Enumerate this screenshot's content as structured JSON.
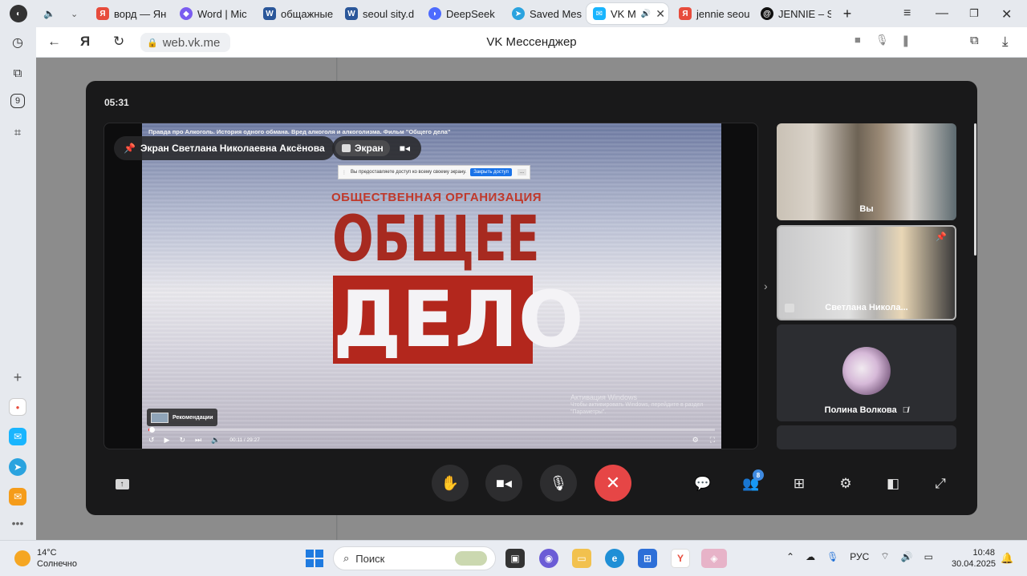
{
  "browser": {
    "tabs": [
      {
        "label": "ворд — Ян",
        "icon": "yandex-icon",
        "color": "#e74c3c"
      },
      {
        "label": "Word | Mic",
        "icon": "copilot-icon",
        "color": "#7a5cf0"
      },
      {
        "label": "общажные",
        "icon": "word-icon",
        "color": "#2b579a"
      },
      {
        "label": "seoul sity.d",
        "icon": "word-icon",
        "color": "#2b579a"
      },
      {
        "label": "DeepSeek",
        "icon": "deepseek-icon",
        "color": "#4d6bfe"
      },
      {
        "label": "Saved Mes",
        "icon": "telegram-icon",
        "color": "#2aa3df"
      },
      {
        "label": "VK M",
        "icon": "vk-messenger-icon",
        "color": "#19b5fe",
        "active": true
      },
      {
        "label": "jennie seou",
        "icon": "yandex-icon",
        "color": "#e74c3c"
      },
      {
        "label": "JENNIE – S",
        "icon": "threads-icon",
        "color": "#111111"
      }
    ],
    "url": "web.vk.me",
    "page_title": "VK Мессенджер"
  },
  "call": {
    "timer": "05:31",
    "screen_share_label": "Экран Светлана Николаевна Аксёнова",
    "screen_tab_label": "Экран",
    "participants": [
      {
        "name": "Вы"
      },
      {
        "name": "Светлана Никола..."
      },
      {
        "name": "Полина Волкова"
      }
    ],
    "participants_count": "8"
  },
  "video": {
    "title": "Правда про Алкоголь. История одного обмана. Вред алкоголя и алкоголизма. Фильм \"Общего дела\"",
    "share_notice": "Вы предоставляете доступ ко всему своему экрану.",
    "share_stop": "Закрыть доступ",
    "share_hide": "...",
    "org_line": "ОБЩЕСТВЕННАЯ ОРГАНИЗАЦИЯ",
    "logo_word1": "ОБЩЕЕ",
    "logo_word2": "ДЕЛО",
    "watermark_l1": "Активация Windows",
    "watermark_l2": "Чтобы активировать Windows, перейдите в раздел",
    "watermark_l3": "\"Параметры\".",
    "recommendations": "Рекомендации",
    "time": "00:11 / 29:27",
    "progress": 0.006
  },
  "taskbar": {
    "temperature": "14°C",
    "weather": "Солнечно",
    "search_placeholder": "Поиск",
    "lang": "РУС",
    "time": "10:48",
    "date": "30.04.2025"
  },
  "colors": {
    "end_call": "#e64646",
    "badge": "#3f8ae0",
    "video_red": "#b3271d"
  }
}
